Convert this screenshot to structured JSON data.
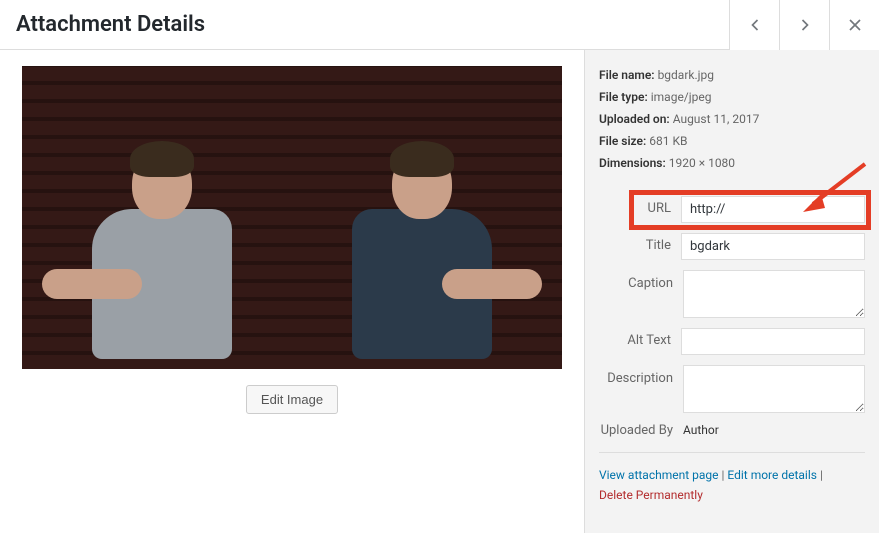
{
  "header": {
    "title": "Attachment Details"
  },
  "preview": {
    "edit_button": "Edit Image"
  },
  "meta": {
    "filename_label": "File name:",
    "filename": "bgdark.jpg",
    "filetype_label": "File type:",
    "filetype": "image/jpeg",
    "uploaded_label": "Uploaded on:",
    "uploaded": "August 11, 2017",
    "filesize_label": "File size:",
    "filesize": "681 KB",
    "dimensions_label": "Dimensions:",
    "dimensions": "1920 × 1080"
  },
  "fields": {
    "url_label": "URL",
    "url_value": "http://",
    "title_label": "Title",
    "title_value": "bgdark",
    "caption_label": "Caption",
    "caption_value": "",
    "alt_label": "Alt Text",
    "alt_value": "",
    "description_label": "Description",
    "description_value": "",
    "uploaded_by_label": "Uploaded By",
    "uploaded_by_value": "Author"
  },
  "links": {
    "view": "View attachment page",
    "edit": "Edit more details",
    "delete": "Delete Permanently",
    "sep": " | "
  }
}
